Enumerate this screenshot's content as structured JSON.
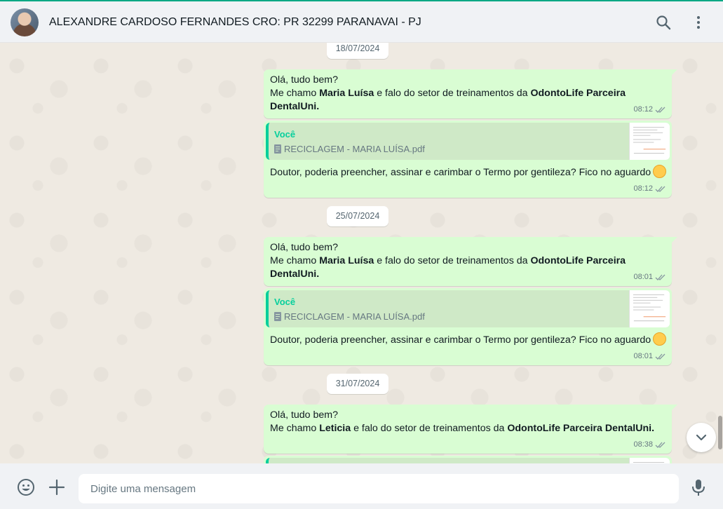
{
  "header": {
    "contact_name": "ALEXANDRE CARDOSO FERNANDES CRO: PR 32299 PARANAVAI - PJ",
    "icons": [
      "search-icon",
      "menu-icon"
    ]
  },
  "chat": {
    "groups": [
      {
        "date": "18/07/2024",
        "intro": {
          "line1": "Olá, tudo bem?",
          "line2_prefix": "Me chamo ",
          "name": "Maria Luísa",
          "line2_mid": " e falo do setor de treinamentos  da ",
          "company": "OdontoLife Parceira DentalUni.",
          "time": "08:12"
        },
        "doc": {
          "author": "Você",
          "file": "RECICLAGEM - MARIA LUÍSA.pdf",
          "text": "Doutor, poderia preencher, assinar e carimbar o Termo por gentileza? Fico no aguardo",
          "time": "08:12"
        }
      },
      {
        "date": "25/07/2024",
        "intro": {
          "line1": "Olá, tudo bem?",
          "line2_prefix": "Me chamo ",
          "name": "Maria Luísa",
          "line2_mid": " e falo do setor de treinamentos  da ",
          "company": "OdontoLife Parceira DentalUni.",
          "time": "08:01"
        },
        "doc": {
          "author": "Você",
          "file": "RECICLAGEM - MARIA LUÍSA.pdf",
          "text": "Doutor, poderia preencher, assinar e carimbar o Termo por gentileza? Fico no aguardo",
          "time": "08:01"
        }
      },
      {
        "date": "31/07/2024",
        "intro": {
          "line1": "Olá, tudo bem?",
          "line2_prefix": "Me chamo ",
          "name": "Leticia",
          "line2_mid": " e falo do setor de treinamentos  da ",
          "company": "OdontoLife Parceira DentalUni.",
          "time": "08:38"
        }
      }
    ]
  },
  "footer": {
    "placeholder": "Digite uma mensagem",
    "icons": [
      "emoji-icon",
      "plus-icon",
      "microphone-icon"
    ]
  },
  "colors": {
    "outgoing_bubble": "#d9fdd3",
    "accent": "#00a884",
    "quote_accent": "#06cf9c",
    "chat_background": "#efeae2"
  }
}
